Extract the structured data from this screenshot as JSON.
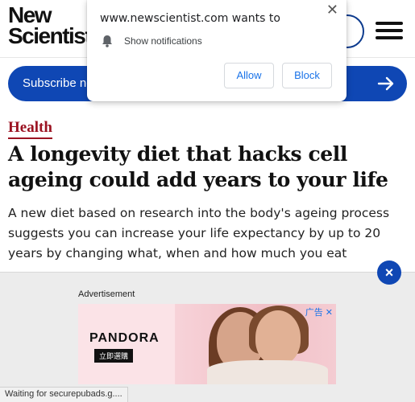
{
  "header": {
    "logo_line1": "New",
    "logo_line2": "Scientist"
  },
  "subscribe": {
    "label": "Subscribe now"
  },
  "article": {
    "section": "Health",
    "headline": "A longevity diet that hacks cell ageing could add years to your life",
    "standfirst": "A new diet based on research into the body's ageing process suggests you can increase your life expectancy by up to 20 years by changing what, when and how much you eat"
  },
  "ad": {
    "label": "Advertisement",
    "brand": "PANDORA",
    "brand_tag": "立即選購",
    "choice": "广告",
    "close_symbol": "×",
    "choice_close": "✕"
  },
  "status_bar": {
    "text": "Waiting for securepubads.g...."
  },
  "permission_popup": {
    "site": "www.newscientist.com wants to",
    "request": "Show notifications",
    "allow_label": "Allow",
    "block_label": "Block",
    "close_symbol": "✕"
  },
  "colors": {
    "brand_blue": "#0f47b4",
    "section_red": "#9b1221",
    "dialog_link_blue": "#1a73e8"
  }
}
